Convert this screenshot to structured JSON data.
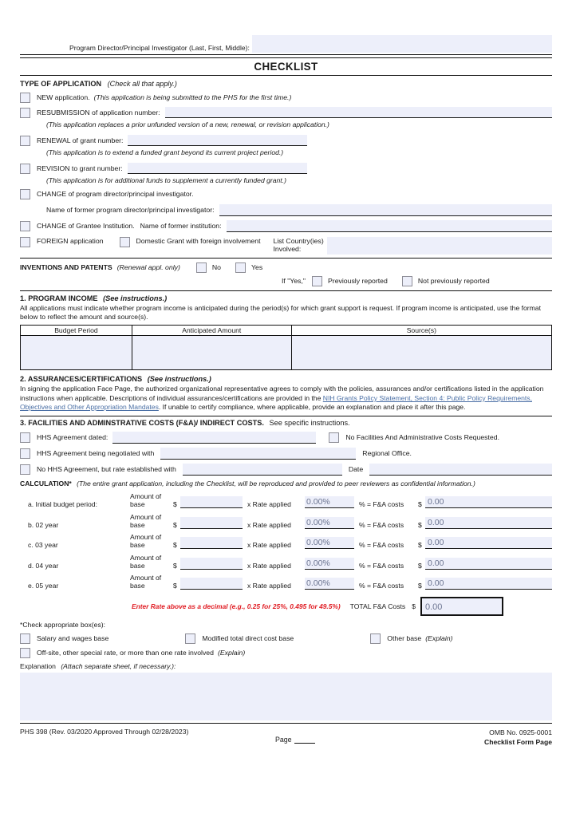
{
  "header": {
    "pi_label": "Program Director/Principal Investigator (Last, First, Middle):",
    "pi_value": "",
    "title": "CHECKLIST"
  },
  "type_of_application": {
    "heading": "TYPE OF APPLICATION",
    "heading_note": "(Check all that apply.)",
    "items": [
      {
        "label": "NEW application.",
        "note": "(This application is being submitted to the PHS for the first time.)",
        "field": false,
        "value": ""
      },
      {
        "label": "RESUBMISSION of application number:",
        "note": "",
        "field": true,
        "value": ""
      },
      {
        "label": "RENEWAL of grant number:",
        "note": "",
        "field": true,
        "value": ""
      },
      {
        "label": "REVISION to grant number:",
        "note": "",
        "field": true,
        "value": ""
      }
    ],
    "sub_resubmission": "(This application replaces a prior unfunded version of a new, renewal, or revision application.)",
    "sub_renewal": "(This application is to extend a funded grant beyond its current project period.)",
    "sub_revision": "(This application is for additional funds to supplement a currently funded grant.)",
    "change_pd": "CHANGE of program director/principal investigator.",
    "former_pd_label": "Name of former program director/principal investigator:",
    "former_pd_value": "",
    "change_grantee": "CHANGE of Grantee Institution.",
    "former_inst_label": "Name of former institution:",
    "former_inst_value": "",
    "foreign_application": "FOREIGN application",
    "domestic_grant": "Domestic Grant with foreign involvement",
    "list_country_label_1": "List Country(ies)",
    "list_country_label_2": "Involved:",
    "list_country_value": ""
  },
  "inventions": {
    "label": "INVENTIONS AND PATENTS",
    "note": "(Renewal appl. only)",
    "no": "No",
    "yes": "Yes",
    "if_yes": "If \"Yes,\"",
    "previously_reported": "Previously reported",
    "not_previously_reported": "Not previously reported"
  },
  "program_income": {
    "heading": "1.  PROGRAM INCOME",
    "heading_note": "(See instructions.)",
    "body": "All applications must indicate whether program income is anticipated during the period(s) for which grant support is request.  If program income is anticipated, use the format below to reflect the amount and source(s).",
    "columns": [
      "Budget Period",
      "Anticipated Amount",
      "Source(s)"
    ],
    "rows": [
      [
        "",
        "",
        ""
      ]
    ]
  },
  "assurances": {
    "heading": "2.  ASSURANCES/CERTIFICATIONS",
    "heading_note": "(See instructions.)",
    "body_1": "In signing the application Face Page, the authorized organizational representative agrees to comply with the policies, assurances and/or certifications listed in the application instructions when applicable. Descriptions of individual assurances/certifications are provided in the ",
    "link_text": "NIH Grants Policy Statement, Section 4: Public Policy Requirements, Objectives and Other Appropriation Mandates",
    "body_2": ". If unable to certify compliance, where applicable, provide an explanation and place it after this page."
  },
  "facilities": {
    "heading": "3.  FACILITIES AND ADMINSTRATIVE COSTS (F&A)/ INDIRECT COSTS.",
    "heading_note": "See specific instructions.",
    "hhs_dated_label": "HHS Agreement dated:",
    "hhs_dated_value": "",
    "no_fa_requested": "No Facilities And Administrative Costs Requested.",
    "hhs_negotiated_label": "HHS Agreement being negotiated with",
    "hhs_negotiated_value": "",
    "regional_office": "Regional Office.",
    "no_hhs_label": "No HHS Agreement, but rate established with",
    "no_hhs_value": "",
    "date_label": "Date",
    "date_value": "",
    "calculation_label": "CALCULATION*",
    "calculation_note": "(The entire grant application, including the Checklist, will be reproduced and provided to peer reviewers as confidential information.)",
    "amount_of_base": "Amount of base",
    "x_rate_applied": "x Rate applied",
    "pct_fa_costs": "% = F&A costs",
    "dollar": "$",
    "rows": [
      {
        "label": "a.  Initial budget period:",
        "base": "",
        "rate": "0.00%",
        "amount": "0.00"
      },
      {
        "label": "b.  02 year",
        "base": "",
        "rate": "0.00%",
        "amount": "0.00"
      },
      {
        "label": "c.  03 year",
        "base": "",
        "rate": "0.00%",
        "amount": "0.00"
      },
      {
        "label": "d.  04 year",
        "base": "",
        "rate": "0.00%",
        "amount": "0.00"
      },
      {
        "label": "e.  05 year",
        "base": "",
        "rate": "0.00%",
        "amount": "0.00"
      }
    ],
    "enter_rate_note": "Enter Rate above as a decimal (e.g., 0.25 for 25%, 0.495 for 49.5%)",
    "total_label": "TOTAL F&A Costs",
    "total_value": "0.00",
    "check_boxes_label": "*Check appropriate box(es):",
    "base_salary": "Salary and wages base",
    "base_modified": "Modified total direct cost base",
    "base_other": "Other base",
    "base_other_note": "(Explain)",
    "base_offsite": "Off-site, other special rate, or more than one rate involved",
    "base_offsite_note": "(Explain)",
    "explanation_label": "Explanation",
    "explanation_note": "(Attach separate sheet, if necessary.):",
    "explanation_value": ""
  },
  "footer": {
    "form_id": "PHS 398 (Rev. 03/2020 Approved Through 02/28/2023)",
    "page_label": "Page",
    "page_value": "",
    "omb": "OMB No. 0925-0001",
    "form_page": "Checklist Form Page"
  },
  "colors": {
    "field_fill": "#edeffa",
    "link": "#4a6fa5",
    "warning": "#e01b22",
    "value_text": "#6b7490"
  }
}
